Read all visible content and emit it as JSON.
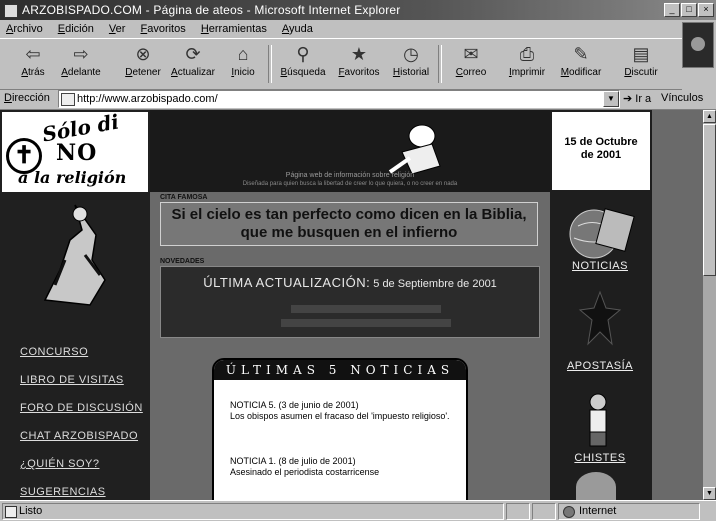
{
  "window": {
    "title": "ARZOBISPADO.COM - Página de ateos - Microsoft Internet Explorer",
    "controls": {
      "minimize": "_",
      "maximize": "□",
      "close": "×"
    }
  },
  "menu": [
    "Archivo",
    "Edición",
    "Ver",
    "Favoritos",
    "Herramientas",
    "Ayuda"
  ],
  "toolbar": [
    {
      "label": "Atrás",
      "icon": "back-icon"
    },
    {
      "label": "Adelante",
      "icon": "forward-icon"
    },
    {
      "label": "Detener",
      "icon": "stop-icon"
    },
    {
      "label": "Actualizar",
      "icon": "refresh-icon"
    },
    {
      "label": "Inicio",
      "icon": "home-icon"
    },
    {
      "label": "Búsqueda",
      "icon": "search-icon"
    },
    {
      "label": "Favoritos",
      "icon": "favorites-icon"
    },
    {
      "label": "Historial",
      "icon": "history-icon"
    },
    {
      "label": "Correo",
      "icon": "mail-icon"
    },
    {
      "label": "Imprimir",
      "icon": "print-icon"
    },
    {
      "label": "Modificar",
      "icon": "edit-icon"
    },
    {
      "label": "Discutir",
      "icon": "discuss-icon"
    }
  ],
  "address": {
    "label": "Dirección",
    "url": "http://www.arzobispado.com/",
    "go_label": "Ir a",
    "links_label": "Vínculos"
  },
  "page": {
    "logo": {
      "line1": "Sólo di",
      "line2": "NO",
      "line3": "a la religión"
    },
    "left_nav": [
      "CONCURSO",
      "LIBRO DE VISITAS",
      "FORO DE DISCUSIÓN",
      "CHAT ARZOBISPADO",
      "¿QUIÉN SOY?",
      "SUGERENCIAS"
    ],
    "banner": {
      "caption1": "Página web de información sobre religión",
      "caption2": "Diseñada para quien busca la libertad de creer lo que quiera, o no creer en nada"
    },
    "quote": {
      "label": "CITA FAMOSA",
      "line1": "Si el cielo es tan perfecto como dicen en la Biblia,",
      "line2": "que me busquen en el infierno"
    },
    "update": {
      "label": "NOVEDADES",
      "title": "ÚLTIMA ACTUALIZACIÓN:",
      "date": "5 de Septiembre de 2001"
    },
    "news": {
      "heading": "ÚLTIMAS 5 NOTICIAS",
      "items": [
        {
          "title": "NOTICIA 5. (3 de junio de 2001)",
          "body": "Los obispos asumen el fracaso del 'impuesto religioso'."
        },
        {
          "title": "NOTICIA 1. (8 de julio de 2001)",
          "body": "Asesinado el periodista costarricense"
        }
      ]
    },
    "date_box": {
      "line1": "15 de Octubre",
      "line2": "de 2001"
    },
    "right_nav": [
      "NOTICIAS",
      "APOSTASÍA",
      "CHISTES"
    ]
  },
  "status": {
    "text": "Listo",
    "zone": "Internet"
  }
}
